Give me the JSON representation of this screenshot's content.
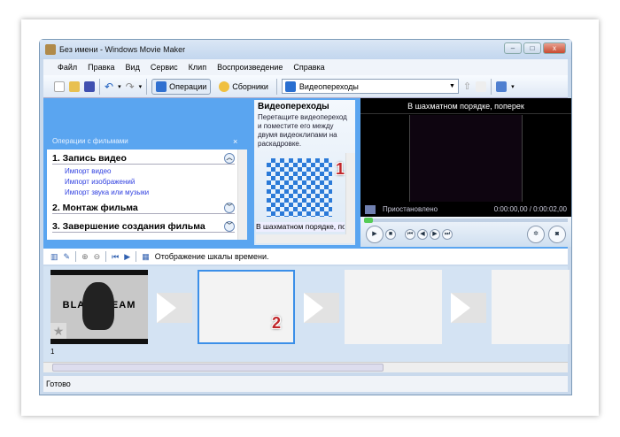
{
  "window": {
    "title": "Без имени - Windows Movie Maker",
    "min": "–",
    "max": "□",
    "close": "x"
  },
  "menu": [
    "Файл",
    "Правка",
    "Вид",
    "Сервис",
    "Клип",
    "Воспроизведение",
    "Справка"
  ],
  "toolbar": {
    "operations": "Операции",
    "collections": "Сборники",
    "combo_value": "Видеопереходы"
  },
  "tasks": {
    "header": "Операции с фильмами",
    "close": "×",
    "sections": [
      {
        "title": "1. Запись видео",
        "links": [
          "Импорт видео",
          "Импорт изображений",
          "Импорт звука или музыки"
        ]
      },
      {
        "title": "2. Монтаж фильма"
      },
      {
        "title": "3. Завершение создания фильма"
      }
    ]
  },
  "transitions": {
    "title": "Видеопереходы",
    "description": "Перетащите видеопереход и поместите его между двумя видеоклипами на раскадровке.",
    "item_label": "В шахматном порядке, поперек",
    "badge": "1"
  },
  "preview": {
    "title": "В шахматном порядке, поперек",
    "status": "Приостановлено",
    "time": "0:00:00,00 / 0:00:02,00",
    "progress": 0
  },
  "storyboard": {
    "toolbar_label": "Отображение шкалы времени.",
    "clip_number": "1",
    "badge": "2",
    "clip_text": "BLACK TEAM"
  },
  "status": "Готово"
}
